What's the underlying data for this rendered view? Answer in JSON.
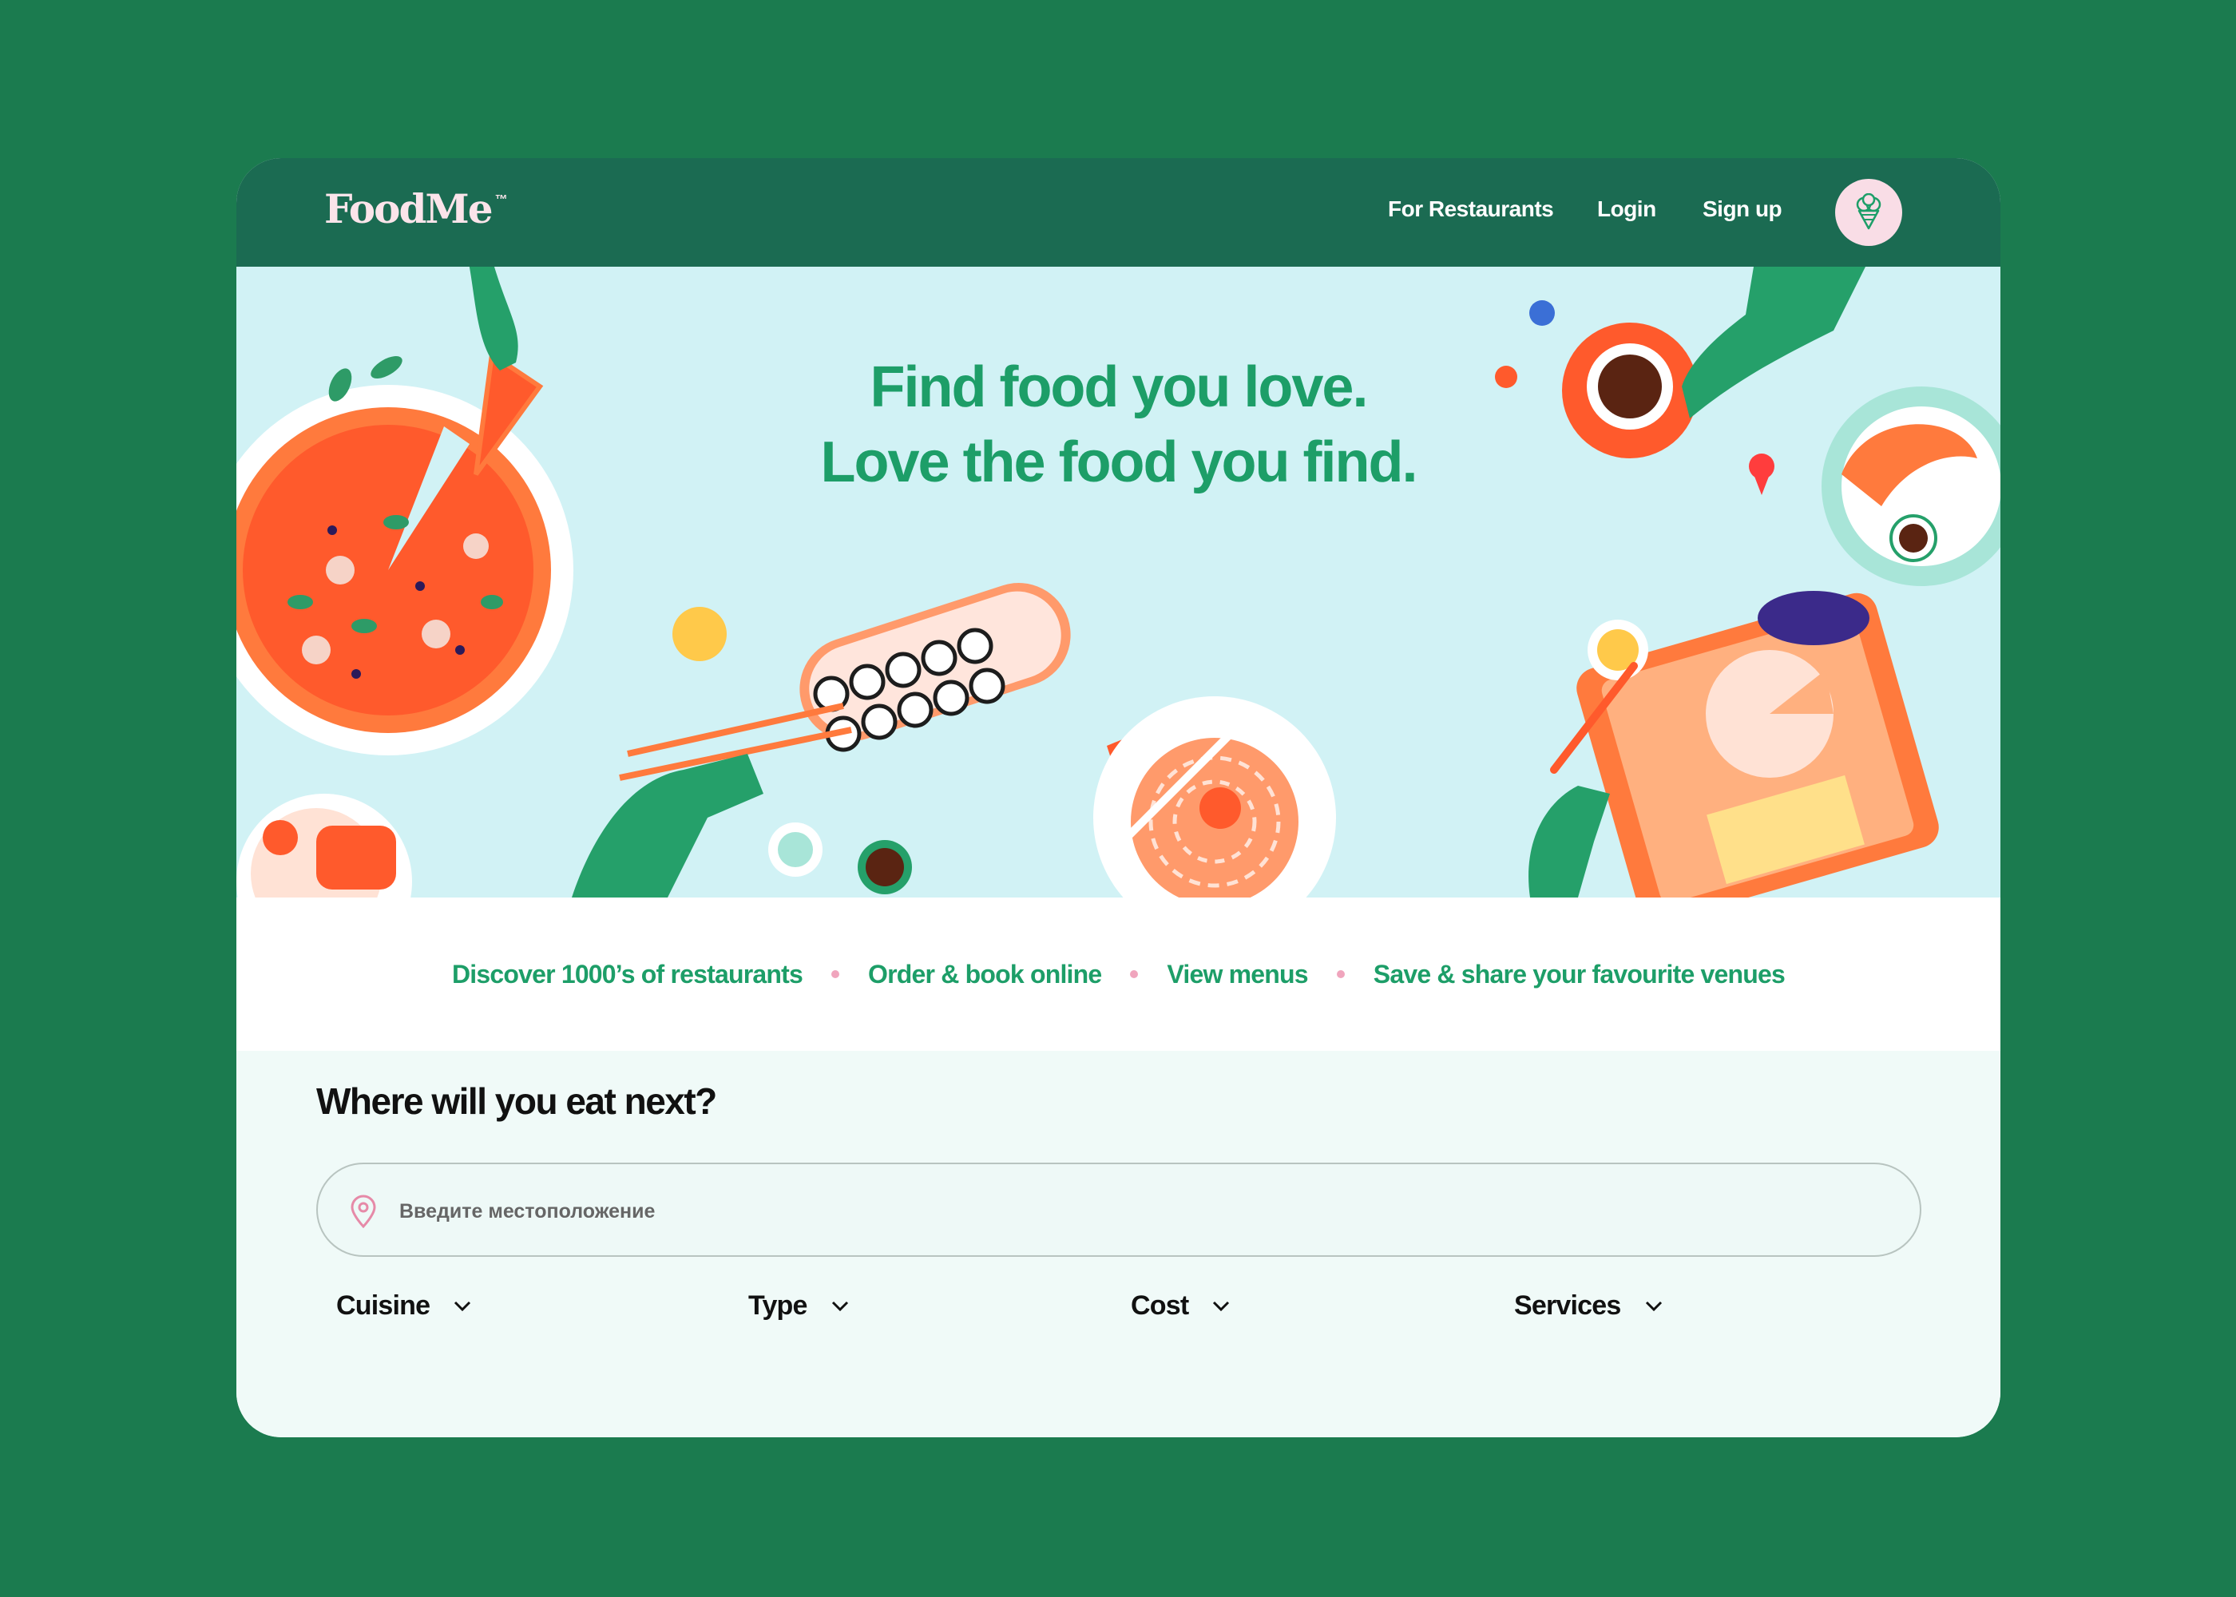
{
  "brand": {
    "name": "FoodMe",
    "trademark": "™"
  },
  "nav": {
    "for_restaurants": "For Restaurants",
    "login": "Login",
    "signup": "Sign up"
  },
  "avatar": {
    "icon": "ice-cream-icon"
  },
  "hero": {
    "headline_line1": "Find food you love.",
    "headline_line2": "Love the food you find."
  },
  "features": [
    "Discover 1000’s of restaurants",
    "Order & book online",
    "View menus",
    "Save & share your favourite venues"
  ],
  "search": {
    "title": "Where will you eat next?",
    "placeholder": "Введите местоположение",
    "icon": "location-pin-icon"
  },
  "filters": [
    {
      "label": "Cuisine",
      "icon": "chevron-down-icon"
    },
    {
      "label": "Type",
      "icon": "chevron-down-icon"
    },
    {
      "label": "Cost",
      "icon": "chevron-down-icon"
    },
    {
      "label": "Services",
      "icon": "chevron-down-icon"
    }
  ],
  "colors": {
    "page_background": "#1b7b4f",
    "topbar": "#1b6b52",
    "hero_background": "#d1f2f5",
    "accent_green": "#1d9e68",
    "tomato": "#ff5a2c",
    "pink_dot": "#f0a5bd"
  }
}
